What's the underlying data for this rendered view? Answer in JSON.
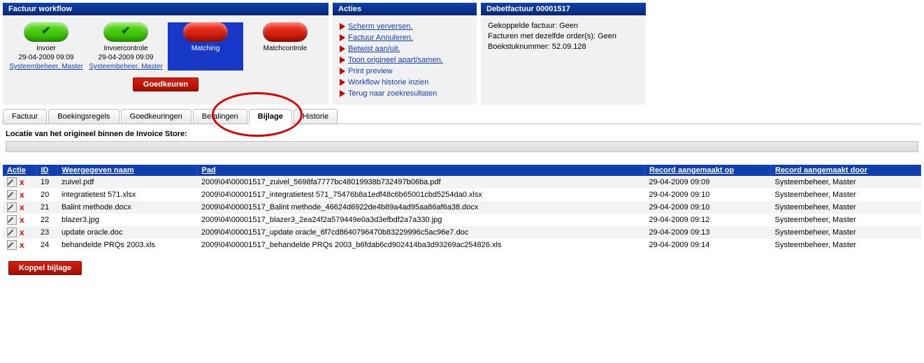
{
  "workflow": {
    "title": "Factuur workflow",
    "steps": [
      {
        "label": "Invoer",
        "ts": "29-04-2009 09:09",
        "user": "Systeembeheer, Master",
        "pill": "green",
        "active": false
      },
      {
        "label": "Invoercontrole",
        "ts": "29-04-2009 09:09",
        "user": "Systeembeheer, Master",
        "pill": "green",
        "active": false
      },
      {
        "label": "Matching",
        "ts": "",
        "user": "",
        "pill": "red",
        "active": true
      },
      {
        "label": "Matchcontrole",
        "ts": "",
        "user": "",
        "pill": "red",
        "active": false
      }
    ],
    "approve_button": "Goedkeuren"
  },
  "acties": {
    "title": "Acties",
    "items": [
      "Scherm verversen.",
      "Factuur Annuleren.",
      "Betwist aan/uit.",
      "Toon origineel apart/samen.",
      "Print preview",
      "Workflow historie inzien",
      "Terug naar zoekresultaten"
    ]
  },
  "debet": {
    "title": "Debetfactuur 00001517",
    "line1": "Gekoppelde factuur: Geen",
    "line2": "Facturen met dezelfde order(s): Geen",
    "line3": "Boekstuknummer: 52.09.128"
  },
  "tabs": [
    "Factuur",
    "Boekingsregels",
    "Goedkeuringen",
    "Betalingen",
    "Bijlage",
    "Historie"
  ],
  "active_tab": "Bijlage",
  "locatie_label": "Locatie van het origineel binnen de Invoice Store:",
  "grid": {
    "headers": [
      "Actie",
      "ID",
      "Weergegeven naam",
      "Pad",
      "Record aangemaakt op",
      "Record aangemaakt door"
    ],
    "rows": [
      {
        "id": "19",
        "name": "zuivel.pdf",
        "path": "2009\\04\\00001517_zuivel_5698fa7777bc48019938b732497b06ba.pdf",
        "date": "29-04-2009 09:09",
        "user": "Systeembeheer, Master"
      },
      {
        "id": "20",
        "name": "integratietest 571.xlsx",
        "path": "2009\\04\\00001517_integratietest 571_75476b8a1edf48c6b65001cbd5254da0.xlsx",
        "date": "29-04-2009 09:10",
        "user": "Systeembeheer, Master"
      },
      {
        "id": "21",
        "name": "Balint methode.docx",
        "path": "2009\\04\\00001517_Balint methode_46624d6922de4b89a4ad95aa86af6a38.docx",
        "date": "29-04-2009 09:10",
        "user": "Systeembeheer, Master"
      },
      {
        "id": "22",
        "name": "blazer3.jpg",
        "path": "2009\\04\\00001517_blazer3_2ea24f2a579449e0a3d3efbdf2a7a330.jpg",
        "date": "29-04-2009 09:12",
        "user": "Systeembeheer, Master"
      },
      {
        "id": "23",
        "name": "update oracle.doc",
        "path": "2009\\04\\00001517_update oracle_6f7cd8640796470b83229996c5ac96e7.doc",
        "date": "29-04-2009 09:13",
        "user": "Systeembeheer, Master"
      },
      {
        "id": "24",
        "name": "behandelde PRQs 2003.xls",
        "path": "2009\\04\\00001517_behandelde PRQs 2003_b6fdab6cd902414ba3d93269ac254826.xls",
        "date": "29-04-2009 09:14",
        "user": "Systeembeheer, Master"
      }
    ]
  },
  "koppel_button": "Koppel bijlage"
}
